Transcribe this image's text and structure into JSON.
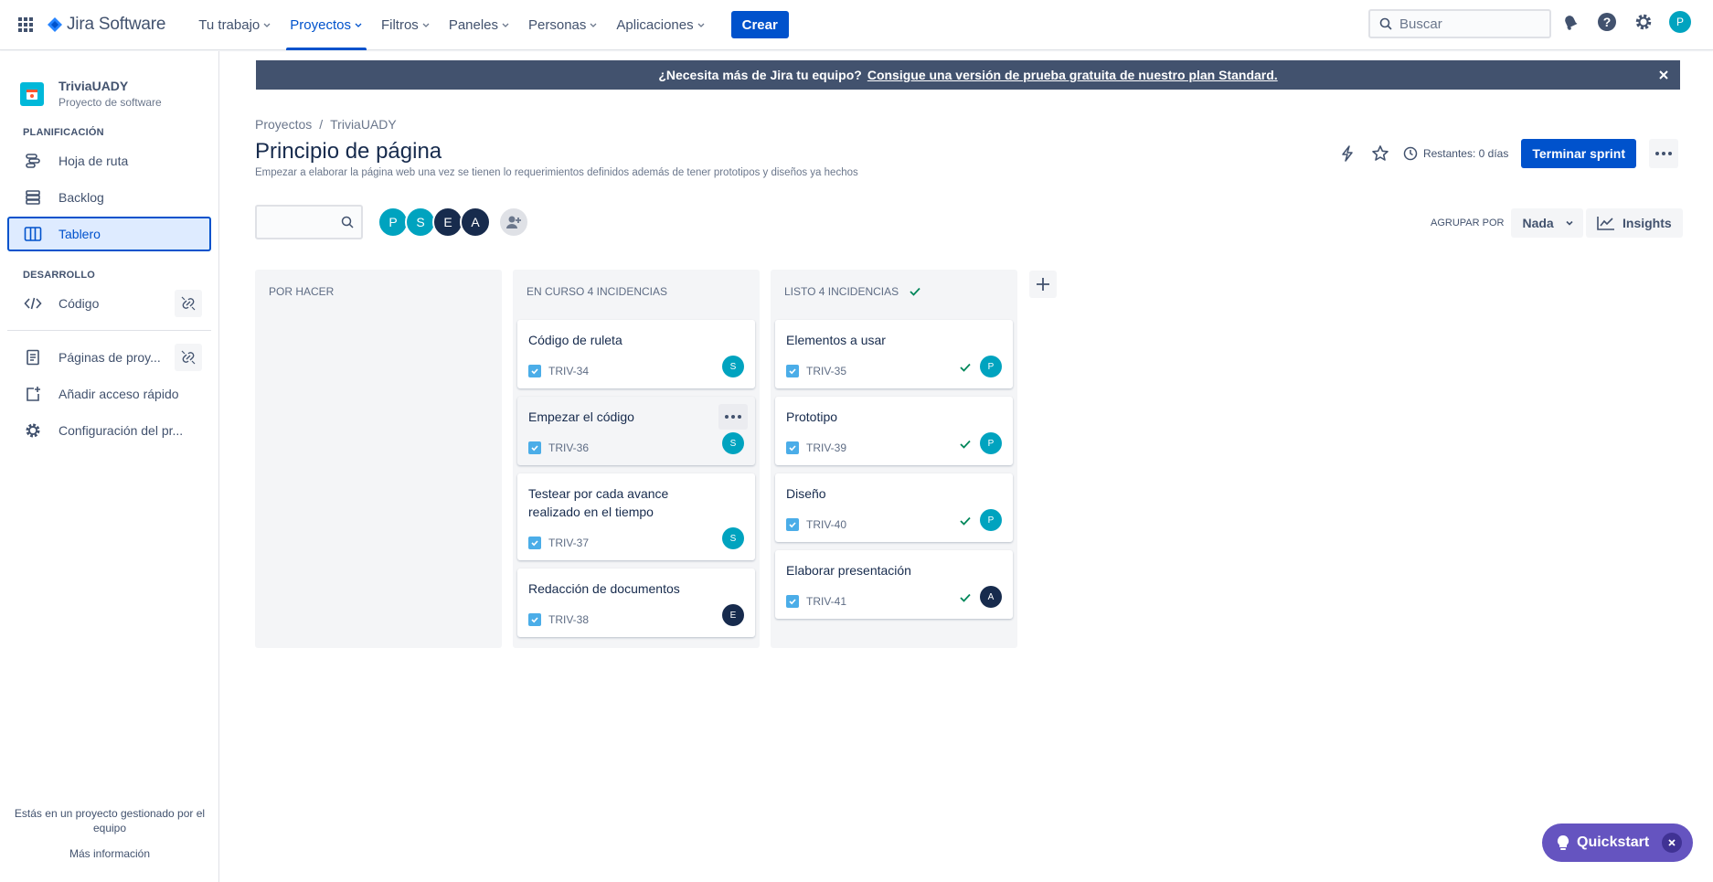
{
  "topnav": {
    "logo": "Jira Software",
    "menu": [
      "Tu trabajo",
      "Proyectos",
      "Filtros",
      "Paneles",
      "Personas",
      "Aplicaciones"
    ],
    "create": "Crear",
    "search_placeholder": "Buscar",
    "user_initial": "P"
  },
  "sidebar": {
    "project_name": "TriviaUADY",
    "project_type": "Proyecto de software",
    "planning_title": "PLANIFICACIÓN",
    "planning_items": [
      "Hoja de ruta",
      "Backlog",
      "Tablero"
    ],
    "dev_title": "DESARROLLO",
    "dev_items": [
      "Código"
    ],
    "extra_items": [
      "Páginas de proy...",
      "Añadir acceso rápido",
      "Configuración del pr..."
    ],
    "footer_text": "Estás en un proyecto gestionado por el equipo",
    "footer_link": "Más información"
  },
  "banner": {
    "text": "¿Necesita más de Jira tu equipo?",
    "link": "Consigue una versión de prueba gratuita de nuestro plan Standard."
  },
  "header": {
    "breadcrumb": [
      "Proyectos",
      "TriviaUADY"
    ],
    "title": "Principio de página",
    "description": "Empezar a elaborar la página web una vez se tienen lo requerimientos definidos además de tener prototipos y diseños ya hechos",
    "remaining": "Restantes: 0 días",
    "end_sprint": "Terminar sprint"
  },
  "filters": {
    "avatars": [
      {
        "initial": "P",
        "color": "#00a3bf"
      },
      {
        "initial": "S",
        "color": "#00a3bf"
      },
      {
        "initial": "E",
        "color": "#172b4d"
      },
      {
        "initial": "A",
        "color": "#172b4d"
      }
    ],
    "group_by_label": "AGRUPAR POR",
    "group_by_value": "Nada",
    "insights": "Insights"
  },
  "columns": [
    {
      "title": "POR HACER",
      "cards": []
    },
    {
      "title": "EN CURSO 4 INCIDENCIAS",
      "cards": [
        {
          "title": "Código de ruleta",
          "key": "TRIV-34",
          "assignee": "S",
          "color": "#00a3bf"
        },
        {
          "title": "Empezar el código",
          "key": "TRIV-36",
          "assignee": "S",
          "color": "#00a3bf"
        },
        {
          "title": "Testear por cada avance realizado en el tiempo",
          "key": "TRIV-37",
          "assignee": "S",
          "color": "#00a3bf"
        },
        {
          "title": "Redacción de documentos",
          "key": "TRIV-38",
          "assignee": "E",
          "color": "#172b4d"
        }
      ]
    },
    {
      "title": "LISTO 4 INCIDENCIAS",
      "cards": [
        {
          "title": "Elementos a usar",
          "key": "TRIV-35",
          "assignee": "P",
          "color": "#00a3bf"
        },
        {
          "title": "Prototipo",
          "key": "TRIV-39",
          "assignee": "P",
          "color": "#00a3bf"
        },
        {
          "title": "Diseño",
          "key": "TRIV-40",
          "assignee": "P",
          "color": "#00a3bf"
        },
        {
          "title": "Elaborar presentación",
          "key": "TRIV-41",
          "assignee": "A",
          "color": "#172b4d"
        }
      ]
    }
  ],
  "quickstart": "Quickstart"
}
